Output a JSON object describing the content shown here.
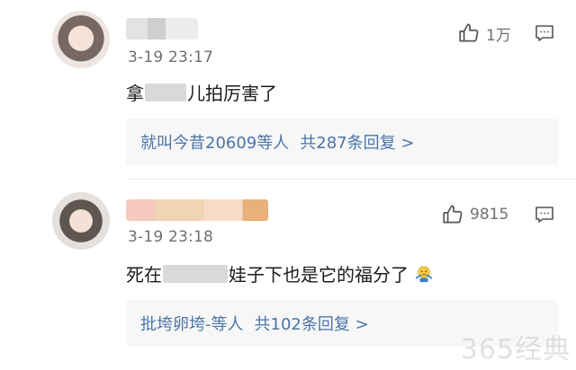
{
  "comments": [
    {
      "time": "3-19 23:17",
      "likes": "1万",
      "text_start": "拿",
      "text_mid": "儿拍",
      "text_end": " 厉害了",
      "reply_users": "就叫今昔20609等人",
      "reply_count": "共287条回复 >"
    },
    {
      "time": "3-19 23:18",
      "likes": "9815",
      "text_start": "死在",
      "text_mid": "",
      "text_end": "娃子下也是它的福分了",
      "emoji": "emoji-face-shrug",
      "reply_users": "批垮卵垮-等人",
      "reply_count": "共102条回复 >"
    }
  ],
  "watermark": "365经典",
  "colors": {
    "link": "#4a74a8",
    "meta": "#6f6f6f",
    "reply_bg": "#f7f7f7"
  }
}
